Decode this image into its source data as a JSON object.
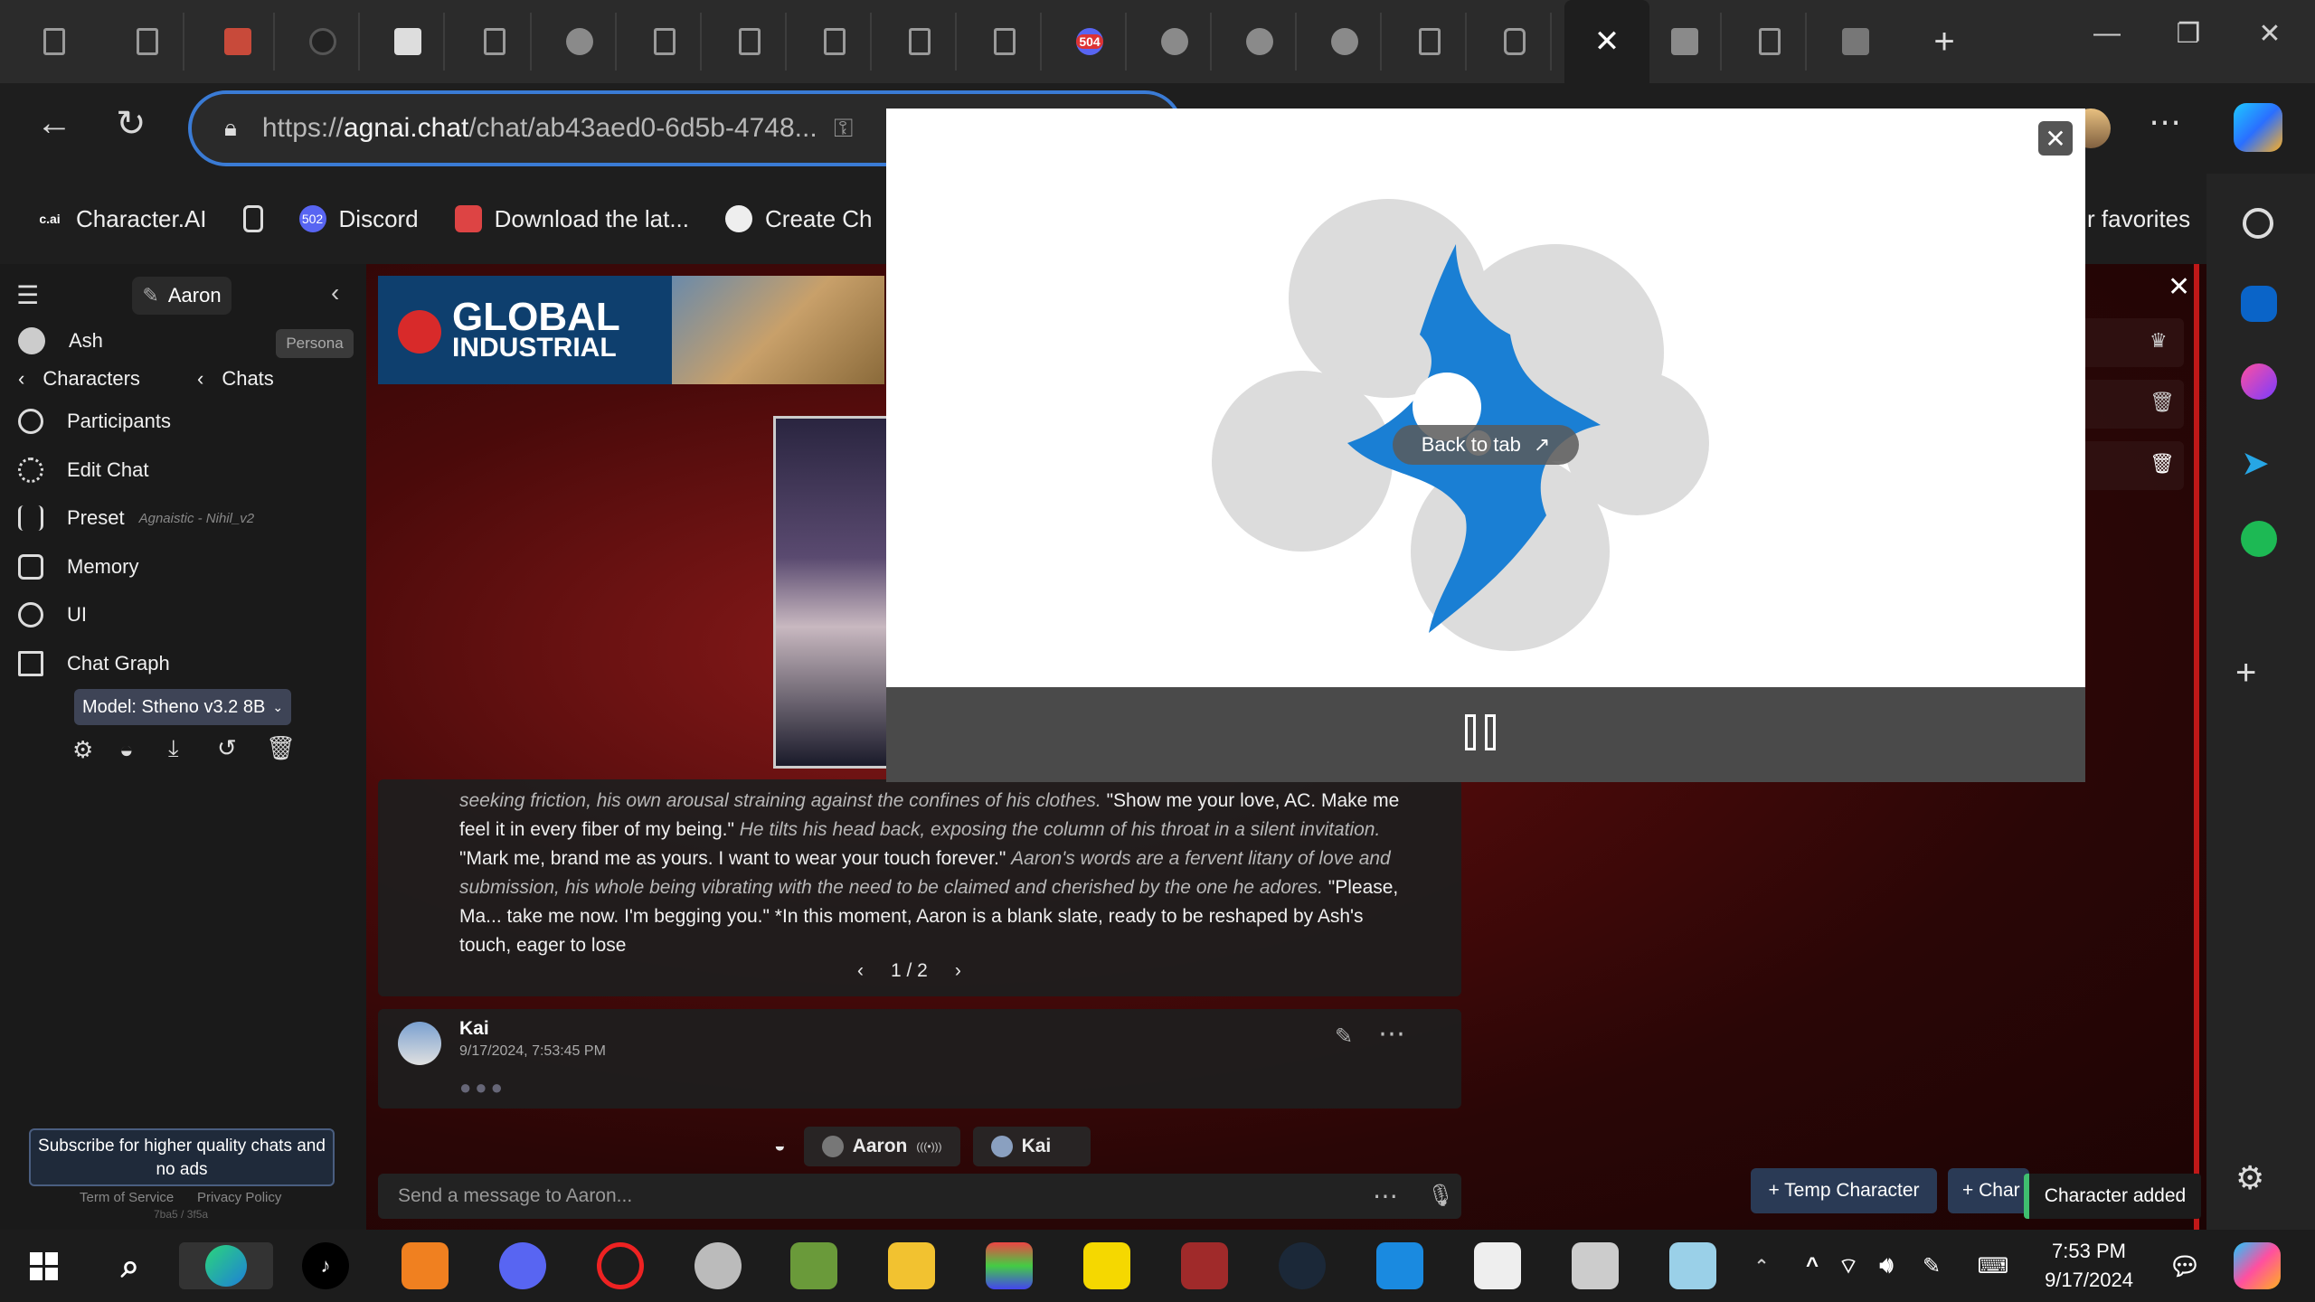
{
  "browser": {
    "url_prefix": "https://",
    "url_domain": "agnai.chat",
    "url_rest": "/chat/ab43aed0-6d5b-4748...",
    "tab_badge": "504",
    "favorites": [
      {
        "icon_text": "c.ai",
        "label": "Character.AI"
      },
      {
        "icon_text": "",
        "label": ""
      },
      {
        "icon_text": "502",
        "label": "Discord"
      },
      {
        "icon_text": "",
        "label": "Download the lat..."
      },
      {
        "icon_text": "",
        "label": "Create Ch"
      }
    ],
    "favorites_overflow": "r favorites"
  },
  "sidebar": {
    "active_character": "Aaron",
    "persona_name": "Ash",
    "persona_badge": "Persona",
    "characters_link": "Characters",
    "chats_link": "Chats",
    "items": [
      {
        "label": "Participants",
        "icon": "users-icon"
      },
      {
        "label": "Edit Chat",
        "icon": "gear-icon"
      },
      {
        "label": "Preset",
        "icon": "sliders-icon",
        "note": "Agnaistic - Nihil_v2"
      },
      {
        "label": "Memory",
        "icon": "book-icon"
      },
      {
        "label": "UI",
        "icon": "palette-icon"
      },
      {
        "label": "Chat Graph",
        "icon": "map-icon"
      }
    ],
    "model_label": "Model: Stheno v3.2 8B",
    "subscribe_text": "Subscribe for higher quality chats and no ads",
    "terms": "Term of Service",
    "privacy": "Privacy Policy",
    "build": "7ba5 / 3f5a"
  },
  "ad": {
    "brand_line1": "GLOBAL",
    "brand_line2": "INDUSTRIAL"
  },
  "message": {
    "segments": [
      {
        "style": "i",
        "text": "seeking friction, his own arousal straining against the confines of his clothes. "
      },
      {
        "style": "n",
        "text": "\"Show me your love, AC. Make me feel it in every fiber of my being.\" "
      },
      {
        "style": "i",
        "text": "He tilts his head back, exposing the column of his throat in a silent invitation. "
      },
      {
        "style": "n",
        "text": "\"Mark me, brand me as yours. I want to wear your touch forever.\" "
      },
      {
        "style": "i",
        "text": "Aaron's words are a fervent litany of love and submission, his whole being vibrating with the need to be claimed and cherished by the one he adores. "
      },
      {
        "style": "n",
        "text": "\"Please, Ma... take me now. I'm begging you.\" *In this moment, Aaron is a blank slate, ready to be reshaped by Ash's touch, eager to lose"
      }
    ],
    "pager": "1 / 2"
  },
  "reply": {
    "author": "Kai",
    "timestamp": "9/17/2024, 7:53:45 PM"
  },
  "participants_chips": [
    {
      "label": "Aaron",
      "suffix": "(((•)))"
    },
    {
      "label": "Kai",
      "suffix": ""
    }
  ],
  "composer": {
    "placeholder": "Send a message to Aaron..."
  },
  "right_panel": {
    "temp_character": "+ Temp Character",
    "add_character": "+ Char",
    "toast": "Character added"
  },
  "pip": {
    "back_to_tab": "Back to tab"
  },
  "taskbar": {
    "time": "7:53 PM",
    "date": "9/17/2024"
  },
  "colors": {
    "accent": "#3a7bd5",
    "toast_ok": "#3fbf6f"
  }
}
